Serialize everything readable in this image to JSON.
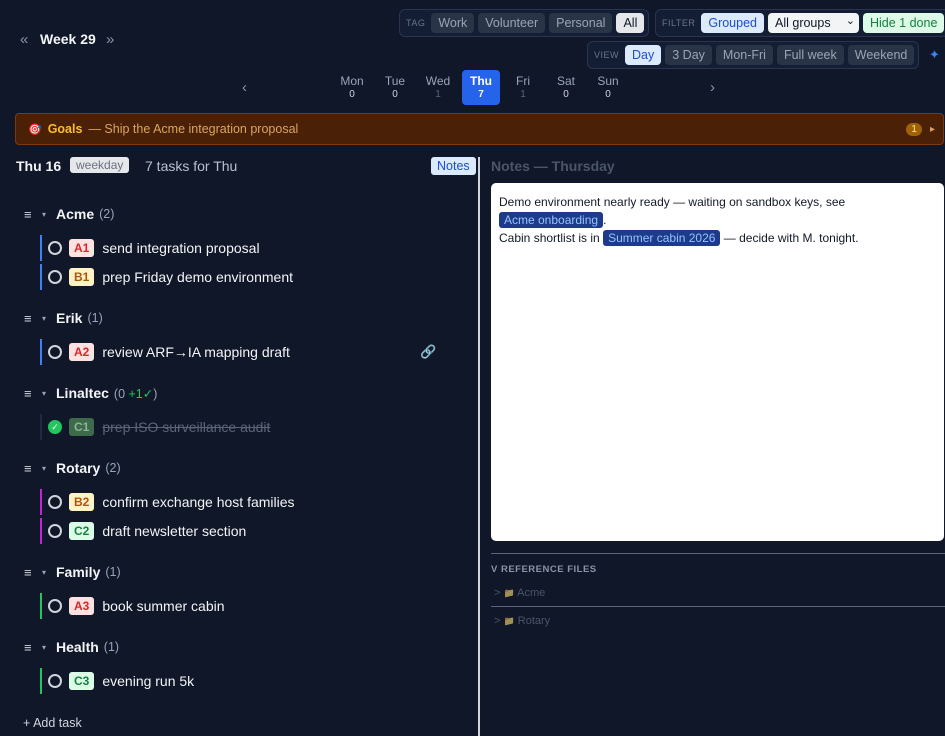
{
  "week": {
    "prev": "«",
    "title": "Week 29",
    "next": "»"
  },
  "tag": {
    "label": "TAG",
    "options": [
      "Work",
      "Volunteer",
      "Personal",
      "All"
    ]
  },
  "filter": {
    "label": "FILTER",
    "grouped": "Grouped",
    "select_value": "All groups",
    "select_caret": "⌄",
    "hide_done": "Hide 1 done"
  },
  "view": {
    "label": "VIEW",
    "options": [
      "Day",
      "3 Day",
      "Mon-Fri",
      "Full week",
      "Weekend"
    ],
    "sparkle": "✦"
  },
  "days": {
    "prev": "‹",
    "next": "›",
    "items": [
      {
        "name": "Mon",
        "count": "0"
      },
      {
        "name": "Tue",
        "count": "0"
      },
      {
        "name": "Wed",
        "count": "1"
      },
      {
        "name": "Thu",
        "count": "7"
      },
      {
        "name": "Fri",
        "count": "1"
      },
      {
        "name": "Sat",
        "count": "0"
      },
      {
        "name": "Sun",
        "count": "0"
      }
    ]
  },
  "goals": {
    "icon": "🎯",
    "title": "Goals",
    "text": "— Ship the Acme integration proposal",
    "badge": "1",
    "caret": "▸"
  },
  "list": {
    "date": "Thu 16",
    "badge": "weekday",
    "count": "7 tasks for Thu",
    "notes_button": "Notes",
    "handle": "≡",
    "caret": "▾",
    "groups": [
      {
        "name": "Acme",
        "count": "(2)"
      },
      {
        "name": "Erik",
        "count": "(1)"
      },
      {
        "name": "Linaltec",
        "count": "(0 ",
        "done": "+1✓",
        "count_end": ")"
      },
      {
        "name": "Rotary",
        "count": "(2)"
      },
      {
        "name": "Family",
        "count": "(1)"
      },
      {
        "name": "Health",
        "count": "(1)"
      }
    ],
    "tasks": [
      {
        "code": "A1",
        "title": "send integration proposal"
      },
      {
        "code": "B1",
        "title": "prep Friday demo environment"
      },
      {
        "code": "A2",
        "title": "review ARF→IA mapping draft",
        "link": "🔗"
      },
      {
        "code": "C1",
        "title": "prep ISO surveillance audit",
        "check": "✓"
      },
      {
        "code": "B2",
        "title": "confirm exchange host families"
      },
      {
        "code": "C2",
        "title": "draft newsletter section"
      },
      {
        "code": "A3",
        "title": "book summer cabin"
      },
      {
        "code": "C3",
        "title": "evening run 5k"
      }
    ],
    "add_task": "+ Add task"
  },
  "notes": {
    "title": "Notes — Thursday",
    "line1": "Demo environment nearly ready — waiting on sandbox keys, see",
    "chip1": "Acme onboarding",
    "line1_end": ".",
    "line2_start": "Cabin shortlist is in",
    "chip2": "Summer cabin 2026",
    "line2_end": "— decide with M. tonight."
  },
  "refs": {
    "title": "V REFERENCE FILES",
    "items": [
      {
        "caret": ">",
        "icon": "📁",
        "name": "Acme"
      },
      {
        "caret": ">",
        "icon": "📁",
        "name": "Rotary"
      }
    ]
  },
  "colors": {
    "background": "#0f1729",
    "accent": "#2563eb",
    "goals_bg": "#4a2106",
    "acme": "#3b82f6",
    "rotary": "#c026d3",
    "family": "#22c55e"
  }
}
